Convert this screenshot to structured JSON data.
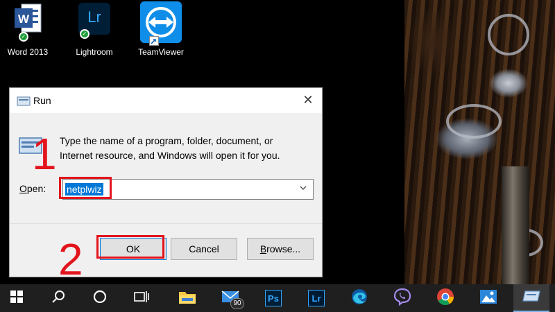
{
  "desktop": {
    "icons": [
      {
        "label": "Word 2013",
        "icon": "word-icon"
      },
      {
        "label": "Lightroom",
        "icon": "lightroom-icon",
        "glyph": "Lr"
      },
      {
        "label": "TeamViewer",
        "icon": "teamviewer-icon"
      }
    ]
  },
  "dialog": {
    "title": "Run",
    "description_line1": "Type the name of a program, folder, document, or",
    "description_line2": "Internet resource, and Windows will open it for you.",
    "open_label_prefix": "O",
    "open_label_rest": "pen:",
    "open_value": "netplwiz",
    "ok_label": "OK",
    "cancel_label": "Cancel",
    "browse_label_prefix": "B",
    "browse_label_rest": "rowse..."
  },
  "annotations": {
    "step1": "1",
    "step2": "2",
    "color": "#e3141c"
  },
  "taskbar": {
    "mail_badge": "90",
    "ps_glyph": "Ps",
    "lr_glyph": "Lr",
    "accent": "#7fb4e8"
  }
}
